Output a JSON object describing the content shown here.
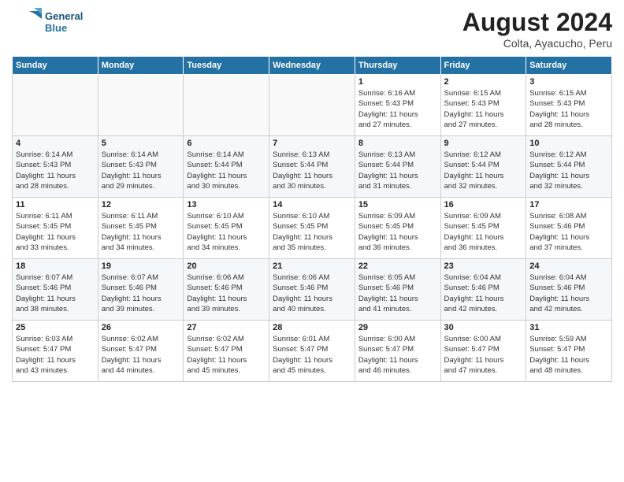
{
  "header": {
    "logo_line1": "General",
    "logo_line2": "Blue",
    "month": "August 2024",
    "location": "Colta, Ayacucho, Peru"
  },
  "days_of_week": [
    "Sunday",
    "Monday",
    "Tuesday",
    "Wednesday",
    "Thursday",
    "Friday",
    "Saturday"
  ],
  "weeks": [
    [
      {
        "day": "",
        "info": ""
      },
      {
        "day": "",
        "info": ""
      },
      {
        "day": "",
        "info": ""
      },
      {
        "day": "",
        "info": ""
      },
      {
        "day": "1",
        "info": "Sunrise: 6:16 AM\nSunset: 5:43 PM\nDaylight: 11 hours\nand 27 minutes."
      },
      {
        "day": "2",
        "info": "Sunrise: 6:15 AM\nSunset: 5:43 PM\nDaylight: 11 hours\nand 27 minutes."
      },
      {
        "day": "3",
        "info": "Sunrise: 6:15 AM\nSunset: 5:43 PM\nDaylight: 11 hours\nand 28 minutes."
      }
    ],
    [
      {
        "day": "4",
        "info": "Sunrise: 6:14 AM\nSunset: 5:43 PM\nDaylight: 11 hours\nand 28 minutes."
      },
      {
        "day": "5",
        "info": "Sunrise: 6:14 AM\nSunset: 5:43 PM\nDaylight: 11 hours\nand 29 minutes."
      },
      {
        "day": "6",
        "info": "Sunrise: 6:14 AM\nSunset: 5:44 PM\nDaylight: 11 hours\nand 30 minutes."
      },
      {
        "day": "7",
        "info": "Sunrise: 6:13 AM\nSunset: 5:44 PM\nDaylight: 11 hours\nand 30 minutes."
      },
      {
        "day": "8",
        "info": "Sunrise: 6:13 AM\nSunset: 5:44 PM\nDaylight: 11 hours\nand 31 minutes."
      },
      {
        "day": "9",
        "info": "Sunrise: 6:12 AM\nSunset: 5:44 PM\nDaylight: 11 hours\nand 32 minutes."
      },
      {
        "day": "10",
        "info": "Sunrise: 6:12 AM\nSunset: 5:44 PM\nDaylight: 11 hours\nand 32 minutes."
      }
    ],
    [
      {
        "day": "11",
        "info": "Sunrise: 6:11 AM\nSunset: 5:45 PM\nDaylight: 11 hours\nand 33 minutes."
      },
      {
        "day": "12",
        "info": "Sunrise: 6:11 AM\nSunset: 5:45 PM\nDaylight: 11 hours\nand 34 minutes."
      },
      {
        "day": "13",
        "info": "Sunrise: 6:10 AM\nSunset: 5:45 PM\nDaylight: 11 hours\nand 34 minutes."
      },
      {
        "day": "14",
        "info": "Sunrise: 6:10 AM\nSunset: 5:45 PM\nDaylight: 11 hours\nand 35 minutes."
      },
      {
        "day": "15",
        "info": "Sunrise: 6:09 AM\nSunset: 5:45 PM\nDaylight: 11 hours\nand 36 minutes."
      },
      {
        "day": "16",
        "info": "Sunrise: 6:09 AM\nSunset: 5:45 PM\nDaylight: 11 hours\nand 36 minutes."
      },
      {
        "day": "17",
        "info": "Sunrise: 6:08 AM\nSunset: 5:46 PM\nDaylight: 11 hours\nand 37 minutes."
      }
    ],
    [
      {
        "day": "18",
        "info": "Sunrise: 6:07 AM\nSunset: 5:46 PM\nDaylight: 11 hours\nand 38 minutes."
      },
      {
        "day": "19",
        "info": "Sunrise: 6:07 AM\nSunset: 5:46 PM\nDaylight: 11 hours\nand 39 minutes."
      },
      {
        "day": "20",
        "info": "Sunrise: 6:06 AM\nSunset: 5:46 PM\nDaylight: 11 hours\nand 39 minutes."
      },
      {
        "day": "21",
        "info": "Sunrise: 6:06 AM\nSunset: 5:46 PM\nDaylight: 11 hours\nand 40 minutes."
      },
      {
        "day": "22",
        "info": "Sunrise: 6:05 AM\nSunset: 5:46 PM\nDaylight: 11 hours\nand 41 minutes."
      },
      {
        "day": "23",
        "info": "Sunrise: 6:04 AM\nSunset: 5:46 PM\nDaylight: 11 hours\nand 42 minutes."
      },
      {
        "day": "24",
        "info": "Sunrise: 6:04 AM\nSunset: 5:46 PM\nDaylight: 11 hours\nand 42 minutes."
      }
    ],
    [
      {
        "day": "25",
        "info": "Sunrise: 6:03 AM\nSunset: 5:47 PM\nDaylight: 11 hours\nand 43 minutes."
      },
      {
        "day": "26",
        "info": "Sunrise: 6:02 AM\nSunset: 5:47 PM\nDaylight: 11 hours\nand 44 minutes."
      },
      {
        "day": "27",
        "info": "Sunrise: 6:02 AM\nSunset: 5:47 PM\nDaylight: 11 hours\nand 45 minutes."
      },
      {
        "day": "28",
        "info": "Sunrise: 6:01 AM\nSunset: 5:47 PM\nDaylight: 11 hours\nand 45 minutes."
      },
      {
        "day": "29",
        "info": "Sunrise: 6:00 AM\nSunset: 5:47 PM\nDaylight: 11 hours\nand 46 minutes."
      },
      {
        "day": "30",
        "info": "Sunrise: 6:00 AM\nSunset: 5:47 PM\nDaylight: 11 hours\nand 47 minutes."
      },
      {
        "day": "31",
        "info": "Sunrise: 5:59 AM\nSunset: 5:47 PM\nDaylight: 11 hours\nand 48 minutes."
      }
    ]
  ]
}
